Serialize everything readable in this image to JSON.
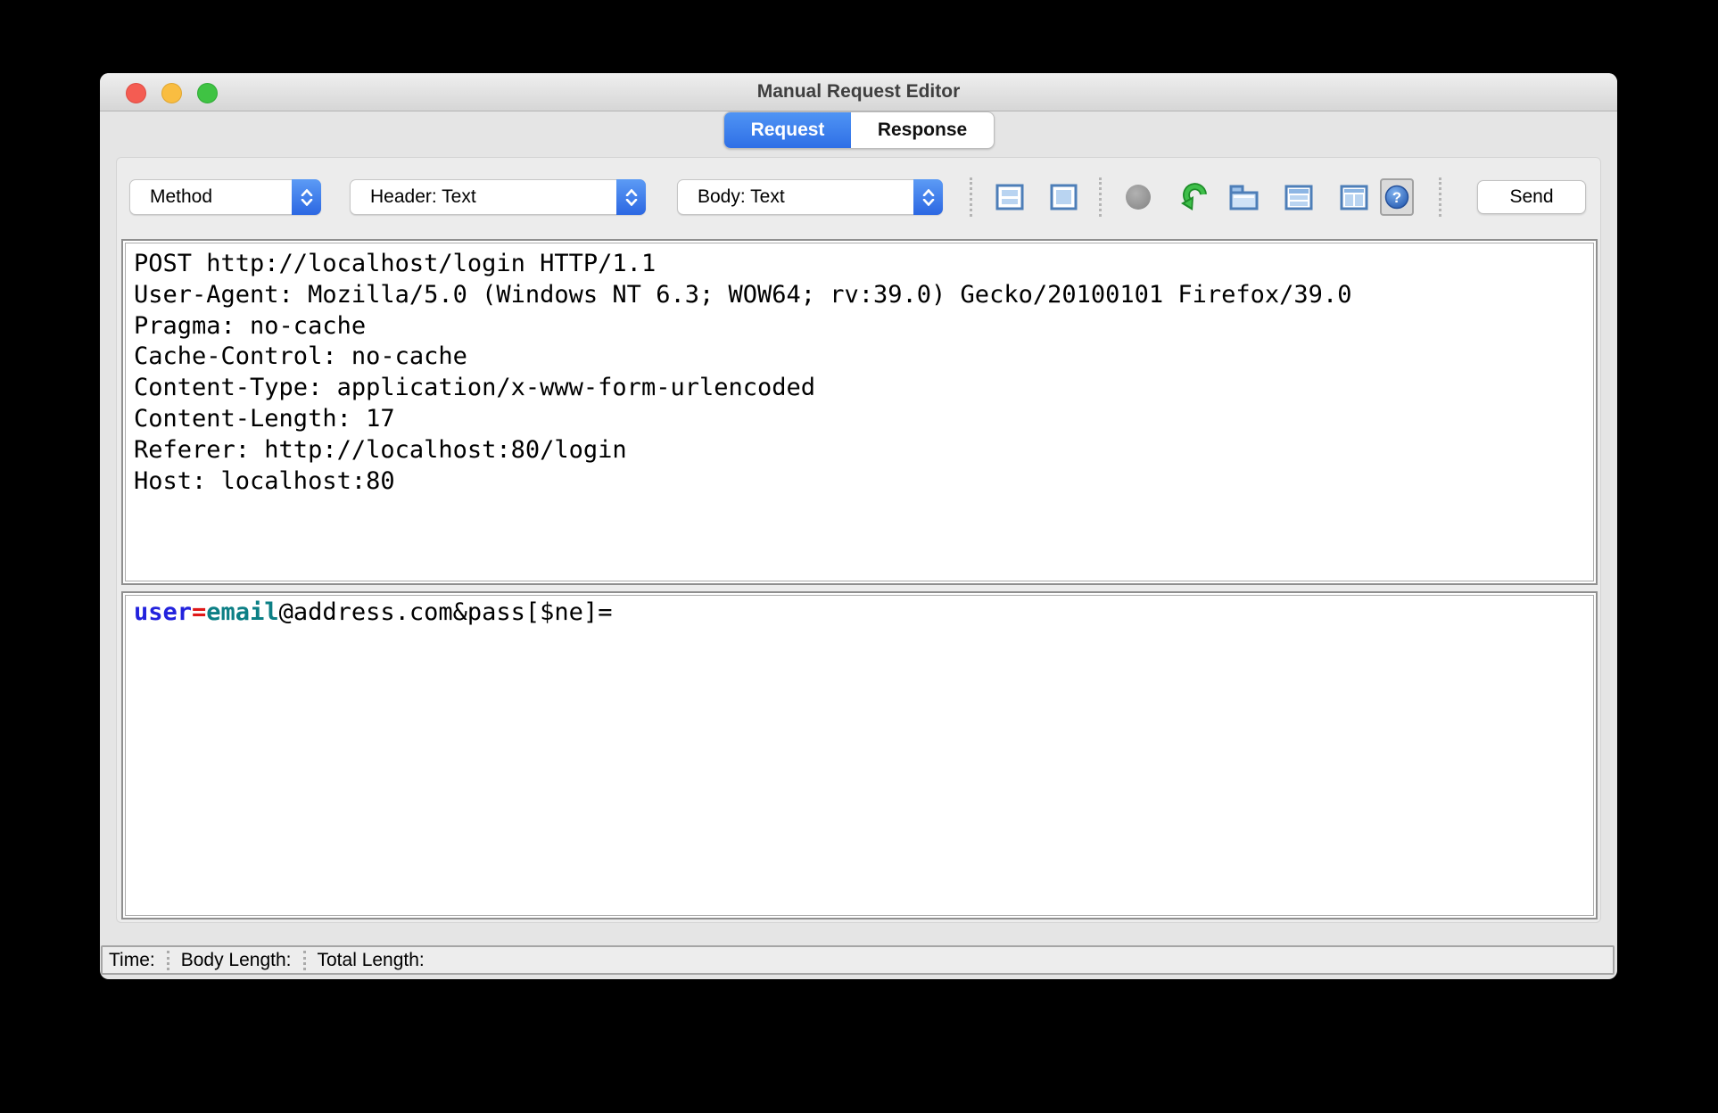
{
  "window": {
    "title": "Manual Request Editor"
  },
  "tabs": {
    "request": {
      "label": "Request",
      "selected": true
    },
    "response": {
      "label": "Response",
      "selected": false
    }
  },
  "toolbar": {
    "method_dropdown": "Method",
    "header_dropdown": "Header: Text",
    "body_dropdown": "Body: Text",
    "send_button": "Send",
    "icons": [
      "combined-view-icon",
      "single-pane-view-icon",
      "record-dot-icon",
      "follow-redirects-icon",
      "tab-view-icon",
      "horizontal-split-icon",
      "vertical-split-icon",
      "help-icon"
    ]
  },
  "request_header": {
    "lines": [
      "POST http://localhost/login HTTP/1.1",
      "User-Agent: Mozilla/5.0 (Windows NT 6.3; WOW64; rv:39.0) Gecko/20100101 Firefox/39.0",
      "Pragma: no-cache",
      "Cache-Control: no-cache",
      "Content-Type: application/x-www-form-urlencoded",
      "Content-Length: 17",
      "Referer: http://localhost:80/login",
      "Host: localhost:80"
    ]
  },
  "request_body": {
    "segments": [
      {
        "text": "user",
        "color": "#2222dd",
        "bold": true
      },
      {
        "text": "=",
        "color": "#e01818",
        "bold": true
      },
      {
        "text": "email",
        "color": "#0c7f85",
        "bold": true
      },
      {
        "text": "@address.com&pass[$ne]=",
        "color": "#000000",
        "bold": false
      }
    ]
  },
  "status_bar": {
    "time_label": "Time:",
    "body_length_label": "Body Length:",
    "total_length_label": "Total Length:"
  },
  "colors": {
    "tab_selected_blue": "#3b82ef",
    "dropdown_cap_blue": "#3a7ce8",
    "icon_border_blue": "#4d7eb8",
    "icon_fill_blue": "#b9d4f1",
    "arrow_green": "#2fae39",
    "record_gray": "#9b9b9b"
  }
}
